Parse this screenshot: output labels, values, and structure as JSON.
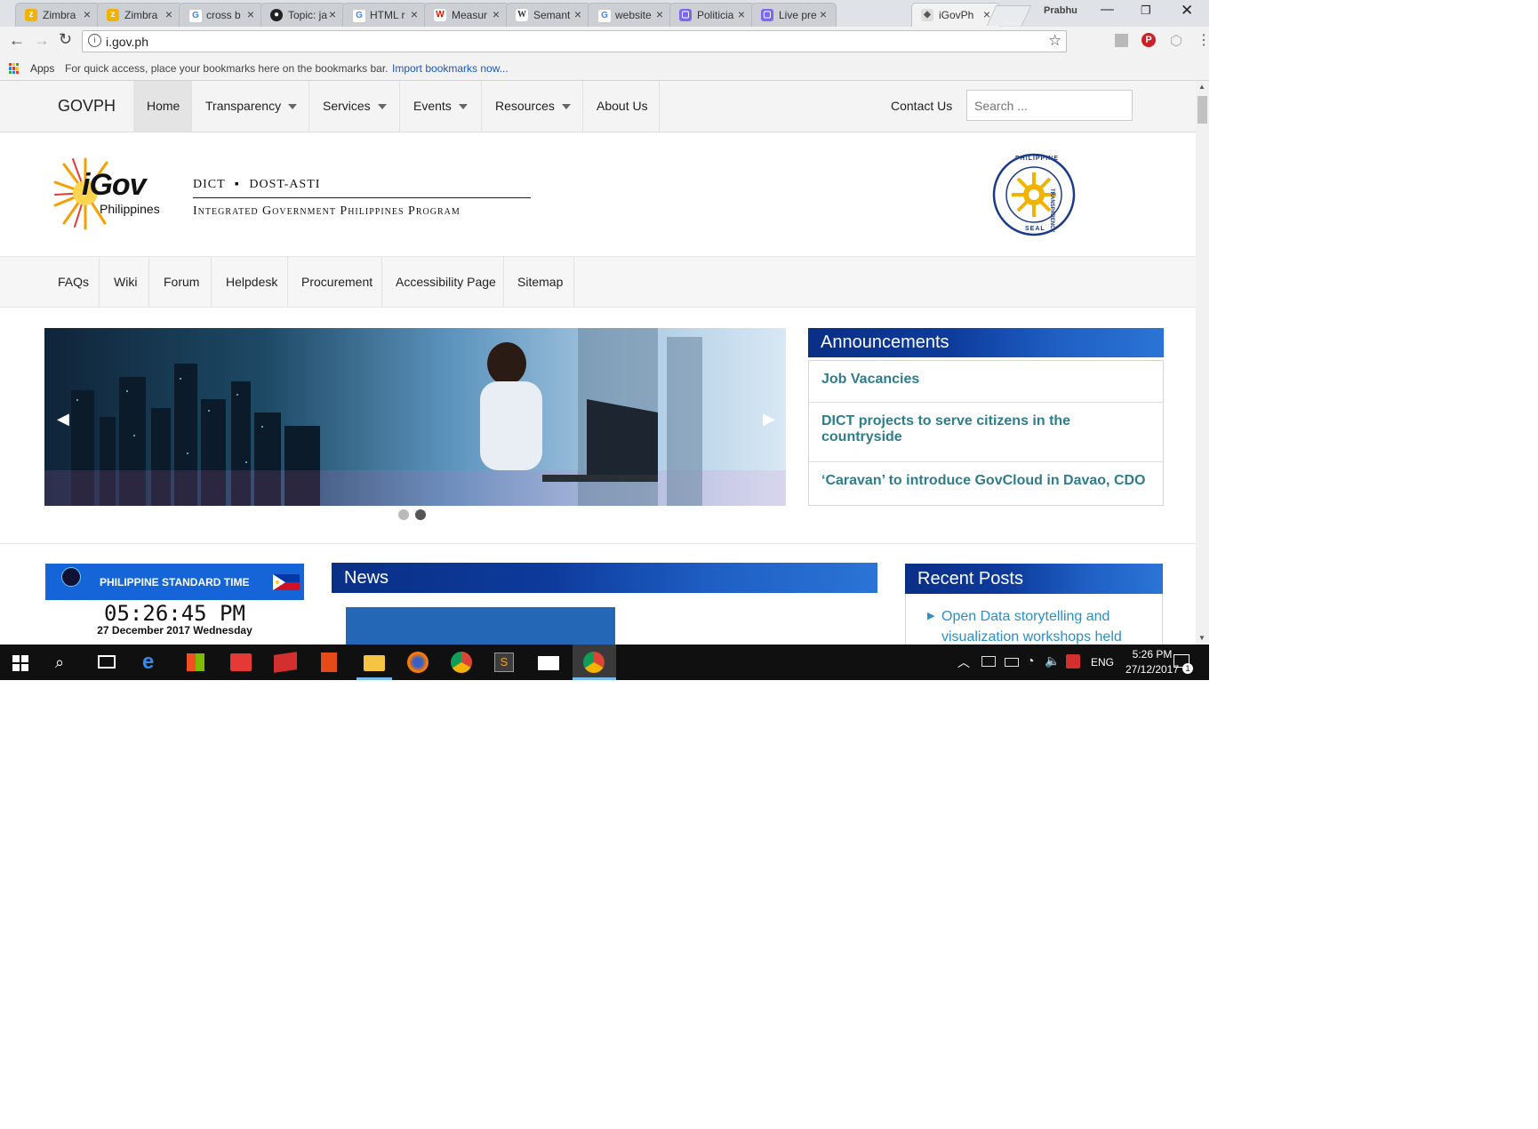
{
  "browser": {
    "tabs": [
      {
        "label": "Zimbra",
        "icon": "zimbra-icon",
        "color": "#f2b200"
      },
      {
        "label": "Zimbra",
        "icon": "zimbra-icon",
        "color": "#f2b200"
      },
      {
        "label": "cross b",
        "icon": "google-icon",
        "color": "#4285f4"
      },
      {
        "label": "Topic: ja",
        "icon": "github-icon",
        "color": "#222222"
      },
      {
        "label": "HTML r",
        "icon": "google-icon",
        "color": "#4285f4"
      },
      {
        "label": "Measur",
        "icon": "wolfram-icon",
        "color": "#dd1100"
      },
      {
        "label": "Semant",
        "icon": "wikipedia-icon",
        "color": "#777777"
      },
      {
        "label": "website",
        "icon": "google-icon",
        "color": "#4285f4"
      },
      {
        "label": "Politicia",
        "icon": "purple-app-icon",
        "color": "#7b68ee"
      },
      {
        "label": "Live pre",
        "icon": "purple-app-icon",
        "color": "#7b68ee"
      },
      {
        "label": "iGovPh",
        "icon": "igov-favicon-icon",
        "color": "#888888"
      }
    ],
    "profile_name": "Prabhu",
    "url": "i.gov.ph",
    "bookmarks": {
      "apps_label": "Apps",
      "hint": "For quick access, place your bookmarks here on the bookmarks bar.",
      "import_link": "Import bookmarks now..."
    }
  },
  "site": {
    "brand": "GOVPH",
    "nav": [
      {
        "label": "Home",
        "dropdown": false
      },
      {
        "label": "Transparency",
        "dropdown": true
      },
      {
        "label": "Services",
        "dropdown": true
      },
      {
        "label": "Events",
        "dropdown": true
      },
      {
        "label": "Resources",
        "dropdown": true
      },
      {
        "label": "About Us",
        "dropdown": false
      }
    ],
    "contact": "Contact Us",
    "search_placeholder": "Search ...",
    "logo": {
      "igov": "iGov",
      "philippines": "Philippines",
      "line1a": "DICT",
      "line1b": "DOST-ASTI",
      "line2": "Integrated Government Philippines Program"
    },
    "seal": {
      "top": "PHILIPPINE",
      "right": "TRANSPARENCY",
      "bottom": "SEAL"
    },
    "subnav": [
      "FAQs",
      "Wiki",
      "Forum",
      "Helpdesk",
      "Procurement",
      "Accessibility Page",
      "Sitemap"
    ],
    "slider": {
      "active_dot": 1,
      "dot_count": 2
    },
    "announcements": {
      "title": "Announcements",
      "items": [
        "Job Vacancies",
        "DICT projects to serve citizens in the countryside",
        "‘Caravan’ to introduce GovCloud in Davao, CDO"
      ]
    },
    "pst": {
      "title": "PHILIPPINE STANDARD TIME",
      "time": "05:26:45 PM",
      "date": "27 December 2017 Wednesday"
    },
    "news": {
      "title": "News"
    },
    "recent_posts": {
      "title": "Recent Posts",
      "items": [
        "Open Data storytelling and visualization workshops held"
      ]
    }
  },
  "taskbar": {
    "language": "ENG",
    "time": "5:26 PM",
    "date": "27/12/2017",
    "notification_count": "1"
  },
  "colors": {
    "accent_teal": "#2e7d8c",
    "banner_blue": "#0d3b9c",
    "pst_blue": "#1565d8"
  }
}
